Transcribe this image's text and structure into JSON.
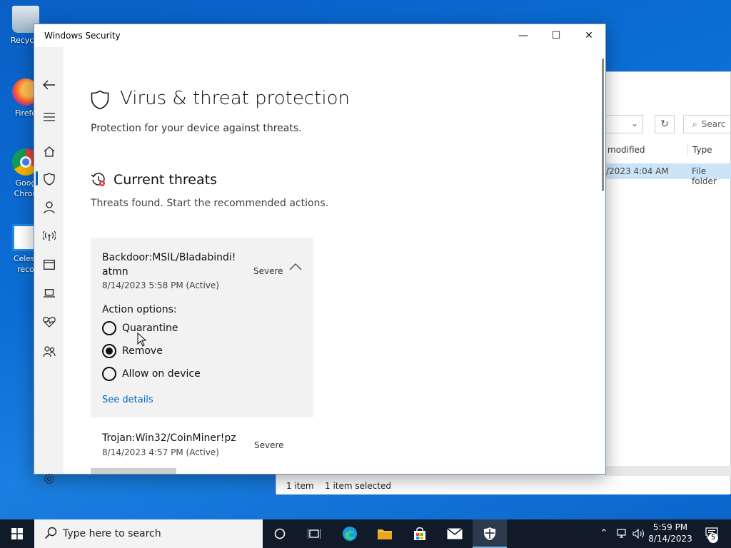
{
  "desktop": {
    "icons": [
      {
        "label": "Recycle",
        "icon": "recycle-bin-icon"
      },
      {
        "label": "Firefo",
        "icon": "firefox-icon"
      },
      {
        "label": "Goog Chron",
        "icon": "chrome-icon"
      },
      {
        "label": "Celest reco",
        "icon": "app-icon"
      }
    ]
  },
  "explorer": {
    "search_placeholder": "Searc",
    "col_modified": "modified",
    "col_type": "Type",
    "row_modified": "/2023 4:04 AM",
    "row_type": "File folder",
    "status_items": "1 item",
    "status_selected": "1 item selected",
    "refresh_icon": "refresh-icon"
  },
  "window": {
    "title": "Windows Security",
    "minimize": "—",
    "maximize": "☐",
    "close": "✕"
  },
  "nav": {
    "icons": [
      "back-icon",
      "menu-icon",
      "home-icon",
      "shield-icon",
      "account-icon",
      "network-icon",
      "app-browser-icon",
      "device-security-icon",
      "health-icon",
      "family-icon",
      "settings-icon"
    ],
    "active": "shield-icon"
  },
  "page": {
    "title": "Virus & threat protection",
    "subtitle": "Protection for your device against threats.",
    "section_title": "Current threats",
    "section_subtitle": "Threats found. Start the recommended actions."
  },
  "threats": [
    {
      "name": "Backdoor:MSIL/Bladabindi!atmn",
      "date": "8/14/2023 5:58 PM (Active)",
      "severity": "Severe",
      "expanded": true,
      "action_label": "Action options:",
      "options": [
        {
          "label": "Quarantine",
          "selected": false
        },
        {
          "label": "Remove",
          "selected": true
        },
        {
          "label": "Allow on device",
          "selected": false
        }
      ],
      "details_link": "See details"
    },
    {
      "name": "Trojan:Win32/CoinMiner!pz",
      "date": "8/14/2023 4:57 PM (Active)",
      "severity": "Severe",
      "expanded": false
    }
  ],
  "taskbar": {
    "search_placeholder": "Type here to search",
    "apps": [
      "cortana-icon",
      "task-view-icon",
      "edge-icon",
      "file-explorer-icon",
      "store-icon",
      "mail-icon",
      "windows-security-icon"
    ],
    "active_app": "windows-security-icon",
    "time": "5:59 PM",
    "date": "8/14/2023",
    "notification_count": "5"
  },
  "colors": {
    "accent": "#0067c0",
    "desktop": "#0b6fd6",
    "taskbar": "#101a28"
  }
}
